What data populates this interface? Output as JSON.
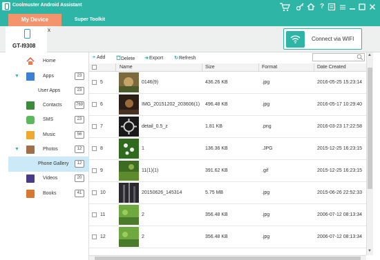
{
  "app": {
    "title": "Coolmuster Android Assistant"
  },
  "titlebar": {
    "icons": [
      "cart-icon",
      "key-icon",
      "home-icon",
      "help-icon",
      "feedback-icon",
      "minimize-icon",
      "maximize-icon",
      "close-icon"
    ]
  },
  "nav": {
    "tabs": [
      {
        "label": "My Device",
        "active": true
      },
      {
        "label": "Super Toolkit",
        "active": false
      }
    ]
  },
  "device": {
    "name": "GT-I9308",
    "close": "x"
  },
  "wifi": {
    "label": "Connect via WIFI"
  },
  "sidebar": {
    "items": [
      {
        "label": "Home",
        "badge": "",
        "icon": "home-icon"
      },
      {
        "label": "Apps",
        "badge": "23",
        "icon": "apps-icon",
        "expanded": true
      },
      {
        "label": "User Apps",
        "badge": "23",
        "icon": ""
      },
      {
        "label": "Contacts",
        "badge": "769",
        "icon": "contacts-icon"
      },
      {
        "label": "SMS",
        "badge": "23",
        "icon": "sms-icon"
      },
      {
        "label": "Music",
        "badge": "56",
        "icon": "music-icon"
      },
      {
        "label": "Photos",
        "badge": "12",
        "icon": "photos-icon",
        "expanded": true
      },
      {
        "label": "Phone Gallery",
        "badge": "12",
        "icon": "",
        "selected": true
      },
      {
        "label": "Videos",
        "badge": "20",
        "icon": "videos-icon"
      },
      {
        "label": "Books",
        "badge": "41",
        "icon": "books-icon"
      }
    ],
    "arrow": "▼"
  },
  "toolbar": {
    "add": "Add",
    "delete": "Delete",
    "export": "Export",
    "refresh": "Refresh",
    "search_placeholder": ""
  },
  "table": {
    "columns": [
      "Name",
      "Size",
      "Format",
      "Date Created"
    ],
    "rows": [
      {
        "index": "5",
        "name": "0146(9)",
        "size": "436.26 KB",
        "format": ".jpg",
        "date": "2016-05-25 15:23:14"
      },
      {
        "index": "6",
        "name": "IMG_20151202_203606(1)",
        "size": "496.48 KB",
        "format": ".jpg",
        "date": "2016-05-17 10:29:40"
      },
      {
        "index": "7",
        "name": "detail_0.5_z",
        "size": "1.81 KB",
        "format": ".png",
        "date": "2016-03-23 17:22:58"
      },
      {
        "index": "8",
        "name": "1",
        "size": "136.36 KB",
        "format": ".JPG",
        "date": "2015-12-25 16:23:15"
      },
      {
        "index": "9",
        "name": "11(1)(1)",
        "size": "391.62 KB",
        "format": ".gif",
        "date": "2015-12-25 16:23:15"
      },
      {
        "index": "10",
        "name": "20150626_145314",
        "size": "5.75 MB",
        "format": ".jpg",
        "date": "2015-06-26 22:52:33"
      },
      {
        "index": "11",
        "name": "2",
        "size": "356.48 KB",
        "format": ".jpg",
        "date": "2006-07-12 08:13:34"
      },
      {
        "index": "12",
        "name": "2",
        "size": "356.48 KB",
        "format": ".jpg",
        "date": "2006-07-12 08:13:34"
      }
    ]
  },
  "colors": {
    "brand": "#2fb5a6",
    "active_tab": "#f4946d",
    "selection": "#cbe9f7"
  }
}
